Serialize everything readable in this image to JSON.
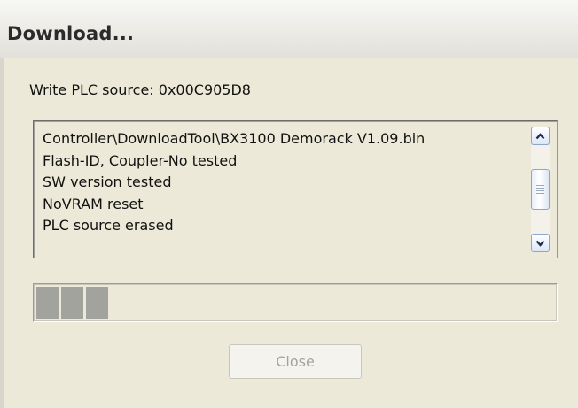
{
  "window": {
    "title": "Download..."
  },
  "status": {
    "text": "Write PLC source: 0x00C905D8"
  },
  "log": {
    "lines": [
      "Controller\\DownloadTool\\BX3100 Demorack V1.09.bin",
      "Flash-ID, Coupler-No tested",
      "SW version tested",
      "NoVRAM reset",
      "PLC source erased"
    ]
  },
  "progress": {
    "filled_blocks": 3,
    "percent_complete": 15
  },
  "buttons": {
    "close_label": "Close",
    "close_enabled": false
  },
  "icons": {
    "scroll_up": "chevron-up-icon",
    "scroll_down": "chevron-down-icon",
    "scroll_grip": "grip-icon"
  },
  "colors": {
    "dialog_background": "#ece9d8",
    "progress_fill": "#a3a39d",
    "disabled_text": "#a4a39c"
  }
}
